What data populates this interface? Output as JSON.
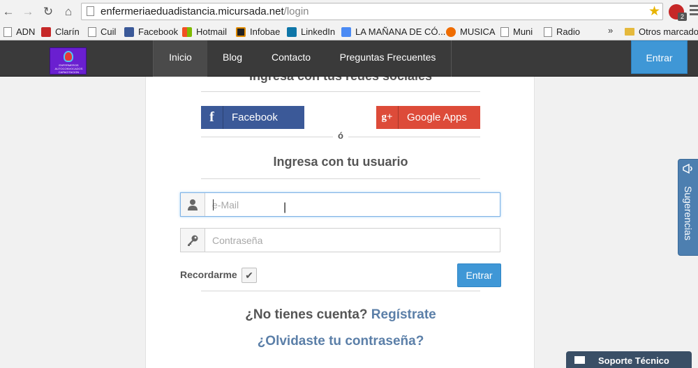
{
  "browser": {
    "url_domain": "enfermeriaeduadistancia.micursada.net",
    "url_path": "/login",
    "back_icon": "arrow-left",
    "forward_icon": "arrow-right",
    "reload_icon": "reload",
    "home_icon": "home",
    "bookmarks": [
      {
        "label": "ADN",
        "icon": "page"
      },
      {
        "label": "Clarín",
        "icon": "clarin"
      },
      {
        "label": "Cuil",
        "icon": "page"
      },
      {
        "label": "Facebook",
        "icon": "facebook"
      },
      {
        "label": "Hotmail",
        "icon": "windows"
      },
      {
        "label": "Infobae",
        "icon": "infobae"
      },
      {
        "label": "LinkedIn",
        "icon": "linkedin"
      },
      {
        "label": "LA MAÑANA DE CÓ...",
        "icon": "google"
      },
      {
        "label": "MUSICA",
        "icon": "musica"
      },
      {
        "label": "Muni",
        "icon": "page"
      },
      {
        "label": "Radio",
        "icon": "page"
      }
    ],
    "overflow_chevron": "»",
    "other_bookmarks": "Otros marcador",
    "extension_badge": "2"
  },
  "site": {
    "logo_text": "ENFERMEROS AUTOCONVOCADOS CAPACITACION",
    "nav": [
      "Inicio",
      "Blog",
      "Contacto",
      "Preguntas Frecuentes"
    ],
    "active_nav": "Inicio",
    "header_login": "Entrar"
  },
  "login": {
    "social_heading": "Ingresa con tus redes sociales",
    "facebook_label": "Facebook",
    "facebook_glyph": "f",
    "google_label": "Google Apps",
    "google_glyph": "g+",
    "or_text": "ó",
    "user_heading": "Ingresa con tu usuario",
    "email_placeholder": "e-Mail",
    "email_value": "",
    "password_placeholder": "Contraseña",
    "password_value": "",
    "remember_label": "Recordarme",
    "remember_checked": true,
    "check_glyph": "✔",
    "submit_label": "Entrar",
    "no_account_text": "¿No tienes cuenta?",
    "register_link": "Regístrate",
    "forgot_link": "¿Olvidaste tu contraseña?"
  },
  "widgets": {
    "suggestions_label": "Sugerencias",
    "support_label": "Soporte Técnico"
  },
  "colors": {
    "header_bg": "#3a3a3a",
    "primary_button": "#3f97d6",
    "facebook": "#3b5998",
    "google": "#dd4b39",
    "link": "#5b7fa8"
  }
}
